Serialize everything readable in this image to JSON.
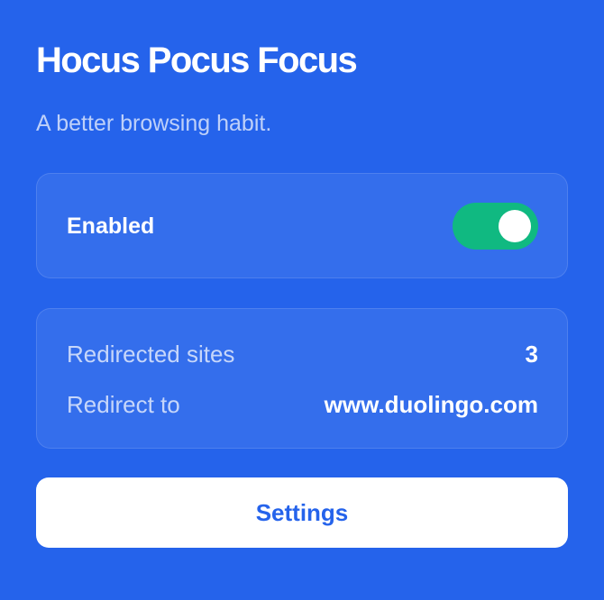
{
  "app": {
    "title": "Hocus Pocus Focus",
    "subtitle": "A better browsing habit."
  },
  "toggle": {
    "label": "Enabled",
    "state": "on",
    "on_color": "#10b981"
  },
  "stats": {
    "redirected_sites": {
      "label": "Redirected sites",
      "value": "3"
    },
    "redirect_to": {
      "label": "Redirect to",
      "value": "www.duolingo.com"
    }
  },
  "settings_button": {
    "label": "Settings"
  },
  "colors": {
    "background": "#2563eb",
    "button_background": "#ffffff",
    "button_text": "#2563eb"
  }
}
